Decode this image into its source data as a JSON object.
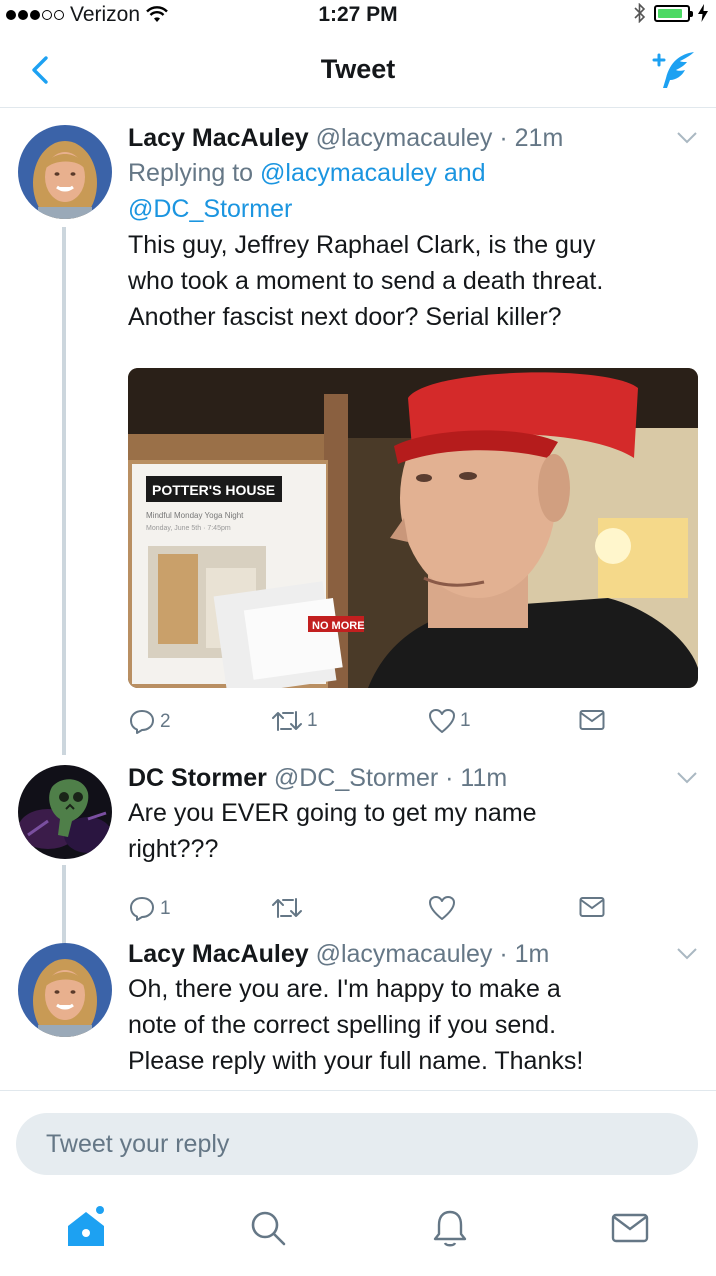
{
  "status_bar": {
    "carrier": "Verizon",
    "time": "1:27 PM",
    "signal_bars_filled": 3,
    "signal_bars_total": 5,
    "battery_level": 0.85,
    "icons": [
      "wifi-icon",
      "bluetooth-icon",
      "battery-icon",
      "charging-bolt-icon"
    ]
  },
  "nav": {
    "title": "Tweet",
    "back_icon": "chevron-left-icon",
    "compose_icon": "compose-tweet-icon"
  },
  "colors": {
    "accent": "#1da1f2",
    "link": "#1b95e0",
    "meta": "#657786",
    "divider": "#e1e8ed",
    "thread_line": "#ccd6dd",
    "input_bg": "#e6ecf0"
  },
  "tweets": [
    {
      "name": "Lacy MacAuley",
      "handle": "@lacymacauley",
      "time": "21m",
      "replying_prefix": "Replying to",
      "replying_to_1": "@lacymacauley",
      "replying_and": "and",
      "replying_to_2": "@DC_Stormer",
      "text_lines": [
        "This guy, Jeffrey Raphael Clark, is the guy",
        "who took a moment to send a death threat.",
        "Another fascist next door? Serial killer?"
      ],
      "media": {
        "sign_title": "POTTER'S HOUSE",
        "sign_line_1": "Mindful Monday Yoga Night",
        "sign_line_2": "Monday, June 5th · 7:45pm",
        "flyer_text": "NO MORE"
      },
      "reply_count": "2",
      "retweet_count": "1",
      "like_count": "1"
    },
    {
      "name": "DC Stormer",
      "handle": "@DC_Stormer",
      "time": "11m",
      "text_lines": [
        "Are you EVER going to get my name",
        "right???"
      ],
      "reply_count": "1",
      "retweet_count": "",
      "like_count": ""
    },
    {
      "name": "Lacy MacAuley",
      "handle": "@lacymacauley",
      "time": "1m",
      "text_lines": [
        "Oh, there you are. I'm happy to make a",
        "note of the correct spelling if you send.",
        "Please reply with your full name. Thanks!"
      ]
    }
  ],
  "reply_box": {
    "placeholder": "Tweet your reply"
  },
  "tab_bar": {
    "tabs": [
      "home-icon",
      "search-icon",
      "notifications-icon",
      "messages-icon"
    ],
    "active": "home-icon"
  }
}
